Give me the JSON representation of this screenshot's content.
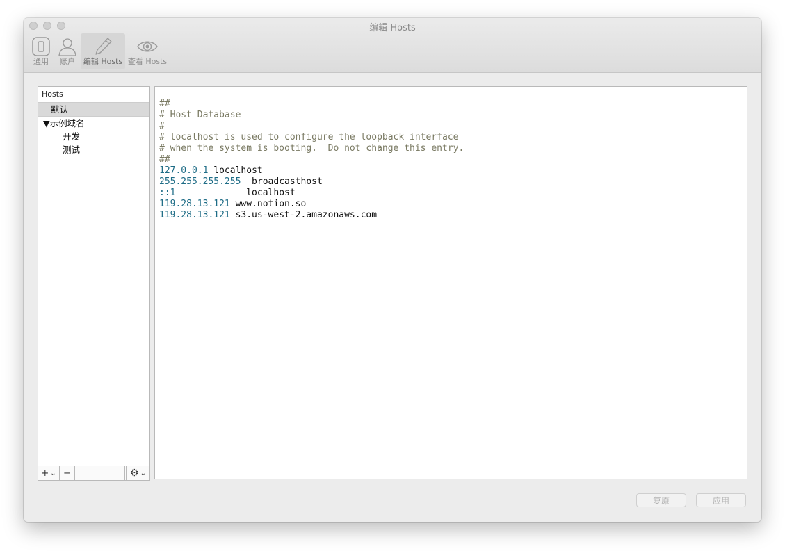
{
  "window": {
    "title": "编辑 Hosts"
  },
  "toolbar": {
    "items": [
      {
        "label": "通用",
        "icon": "general-icon"
      },
      {
        "label": "账户",
        "icon": "account-icon"
      },
      {
        "label": "编辑 Hosts",
        "icon": "pencil-icon",
        "active": true
      },
      {
        "label": "查看 Hosts",
        "icon": "eye-icon"
      }
    ]
  },
  "sidebar": {
    "header": "Hosts",
    "items": [
      {
        "label": "默认",
        "selected": true
      },
      {
        "label": "▼示例域名",
        "group": true
      },
      {
        "label": "开发"
      },
      {
        "label": "测试"
      }
    ],
    "footer": {
      "add": "+",
      "add_arrow": "⌄",
      "remove": "−",
      "gear": "⚙",
      "gear_arrow": "⌄"
    }
  },
  "editor": {
    "lines": [
      {
        "type": "comment",
        "text": "##"
      },
      {
        "type": "comment",
        "text": "# Host Database"
      },
      {
        "type": "comment",
        "text": "#"
      },
      {
        "type": "comment",
        "text": "# localhost is used to configure the loopback interface"
      },
      {
        "type": "comment",
        "text": "# when the system is booting.  Do not change this entry."
      },
      {
        "type": "comment",
        "text": "##"
      },
      {
        "type": "entry",
        "ip": "127.0.0.1",
        "host": " localhost"
      },
      {
        "type": "entry",
        "ip": "255.255.255.255",
        "host": "  broadcasthost"
      },
      {
        "type": "entry",
        "ip": "::1",
        "host": "             localhost"
      },
      {
        "type": "entry",
        "ip": "119.28.13.121",
        "host": " www.notion.so"
      },
      {
        "type": "entry",
        "ip": "119.28.13.121",
        "host": " s3.us-west-2.amazonaws.com"
      }
    ]
  },
  "buttons": {
    "revert": "复原",
    "apply": "应用"
  }
}
